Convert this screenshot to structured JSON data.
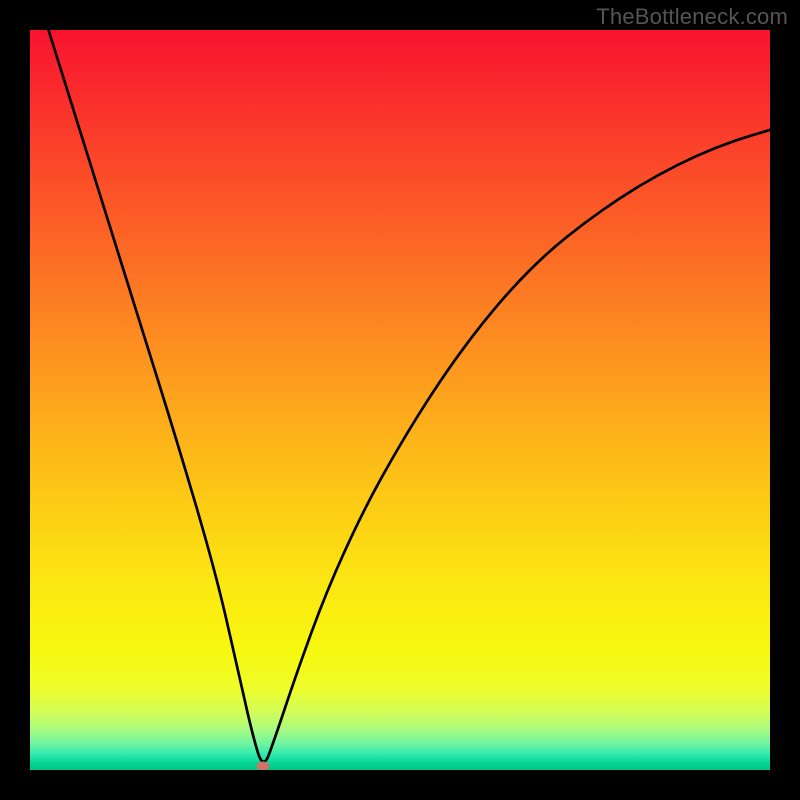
{
  "watermark": "TheBottleneck.com",
  "chart_data": {
    "type": "line",
    "title": "",
    "xlabel": "",
    "ylabel": "",
    "xlim": [
      0,
      100
    ],
    "ylim": [
      0,
      100
    ],
    "grid": false,
    "legend": false,
    "series": [
      {
        "name": "bottleneck-curve",
        "x": [
          0,
          5,
          10,
          15,
          20,
          25,
          28,
          30,
          31.5,
          33,
          36,
          40,
          45,
          50,
          55,
          60,
          65,
          70,
          75,
          80,
          85,
          90,
          95,
          100
        ],
        "values": [
          108,
          92,
          76,
          60,
          44,
          27,
          14,
          5,
          0,
          4,
          13,
          24,
          35,
          44,
          52,
          59,
          65,
          70,
          74,
          77.5,
          80.5,
          83,
          85,
          86.5
        ]
      }
    ],
    "annotations": [
      {
        "name": "minimum-point",
        "x": 31.5,
        "y": 0.5,
        "color": "#cf7468"
      }
    ],
    "background_gradient": {
      "orientation": "vertical",
      "stops": [
        {
          "pos": 0.0,
          "color": "#f8132f"
        },
        {
          "pos": 0.3,
          "color": "#fc6a25"
        },
        {
          "pos": 0.66,
          "color": "#fdd114"
        },
        {
          "pos": 0.9,
          "color": "#d5fd55"
        },
        {
          "pos": 0.98,
          "color": "#2be8af"
        },
        {
          "pos": 1.0,
          "color": "#04c57e"
        }
      ]
    }
  }
}
